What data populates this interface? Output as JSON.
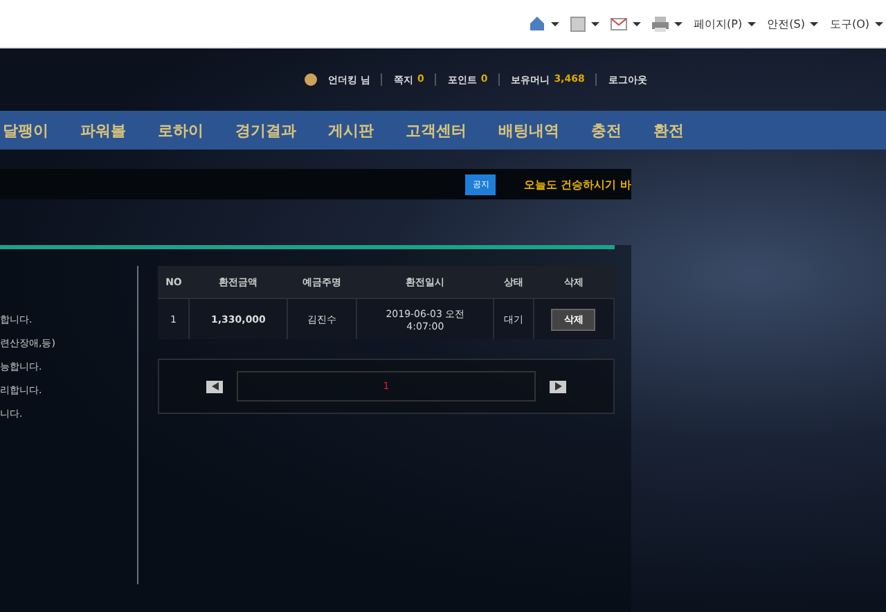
{
  "toolbar": {
    "items": [
      {
        "kind": "home"
      },
      {
        "kind": "feed"
      },
      {
        "kind": "mail"
      },
      {
        "kind": "print"
      },
      {
        "kind": "menu",
        "label": "페이지(P)"
      },
      {
        "kind": "menu",
        "label": "안전(S)"
      },
      {
        "kind": "menu",
        "label": "도구(O)"
      }
    ]
  },
  "user_bar": {
    "username": "언더킹 님",
    "items": [
      {
        "label": "쪽지",
        "value": "0"
      },
      {
        "label": "포인트",
        "value": "0"
      },
      {
        "label": "보유머니",
        "value": "3,468"
      }
    ],
    "logout": "로그아웃"
  },
  "nav": [
    "달팽이",
    "파워볼",
    "로하이",
    "경기결과",
    "게시판",
    "고객센터",
    "배팅내역",
    "충전",
    "환전"
  ],
  "notice": {
    "badge": "공지",
    "text": "오늘도 건승하시기 바"
  },
  "info_lines": [
    "합니다.",
    "련산장애,등)",
    "능합니다.",
    "리합니다.",
    "니다."
  ],
  "table": {
    "columns": [
      "NO",
      "환전금액",
      "예금주명",
      "환전일시",
      "상태",
      "삭제"
    ],
    "rows": [
      {
        "no": "1",
        "amount": "1,330,000",
        "holder": "김진수",
        "date": [
          "2019-06-03 오전",
          "4:07:00"
        ],
        "status": "대기",
        "action": "삭제"
      }
    ]
  },
  "pager": {
    "pages": [
      {
        "label": "1",
        "selected": true
      }
    ]
  }
}
